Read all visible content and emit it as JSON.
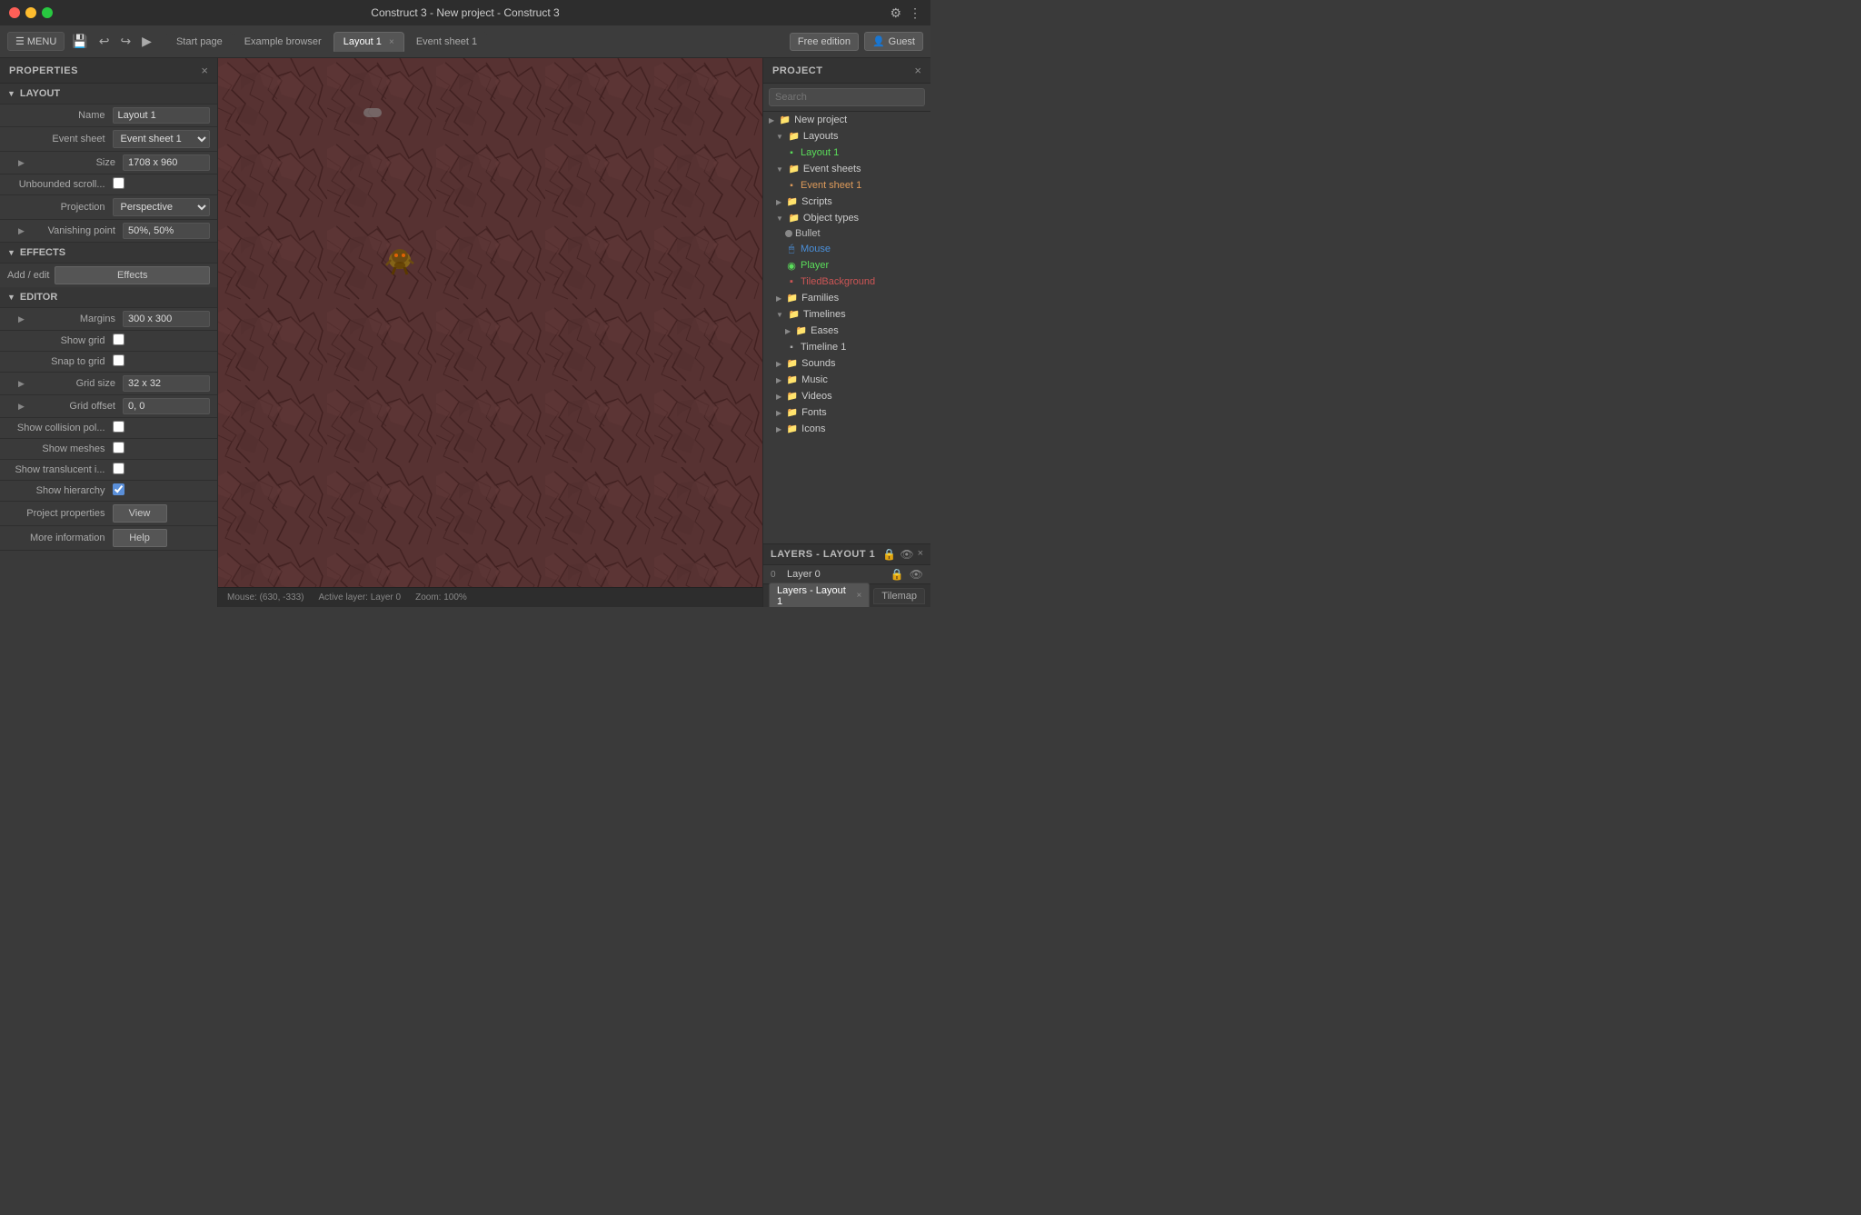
{
  "titlebar": {
    "title": "Construct 3 - New project - Construct 3",
    "close_label": "×",
    "settings_icon": "⚙",
    "dots_icon": "⋮"
  },
  "toolbar": {
    "menu_label": "MENU",
    "undo_icon": "↩",
    "redo_icon": "↪",
    "play_icon": "▶",
    "tabs": [
      {
        "id": "start",
        "label": "Start page",
        "active": false,
        "closable": false
      },
      {
        "id": "example",
        "label": "Example browser",
        "active": false,
        "closable": false
      },
      {
        "id": "layout1",
        "label": "Layout 1",
        "active": true,
        "closable": true
      },
      {
        "id": "eventsheet1",
        "label": "Event sheet 1",
        "active": false,
        "closable": false
      }
    ],
    "free_edition_label": "Free edition",
    "guest_label": "Guest"
  },
  "properties": {
    "panel_title": "PROPERTIES",
    "sections": {
      "layout": {
        "header": "LAYOUT",
        "name_label": "Name",
        "name_value": "Layout 1",
        "event_sheet_label": "Event sheet",
        "event_sheet_value": "Event sheet 1",
        "size_label": "Size",
        "size_value": "1708 x 960",
        "unbounded_scroll_label": "Unbounded scroll...",
        "projection_label": "Projection",
        "projection_value": "Perspective",
        "vanishing_point_label": "Vanishing point",
        "vanishing_point_value": "50%, 50%"
      },
      "effects": {
        "header": "EFFECTS",
        "add_edit_label": "Add / edit",
        "effects_btn_label": "Effects"
      },
      "editor": {
        "header": "EDITOR",
        "margins_label": "Margins",
        "margins_value": "300 x 300",
        "show_grid_label": "Show grid",
        "snap_to_grid_label": "Snap to grid",
        "grid_size_label": "Grid size",
        "grid_size_value": "32 x 32",
        "grid_offset_label": "Grid offset",
        "grid_offset_value": "0, 0",
        "show_collision_label": "Show collision pol...",
        "show_meshes_label": "Show meshes",
        "show_translucent_label": "Show translucent i...",
        "show_hierarchy_label": "Show hierarchy",
        "project_properties_label": "Project properties",
        "project_properties_btn": "View",
        "more_info_label": "More information",
        "more_info_btn": "Help"
      }
    }
  },
  "project": {
    "panel_title": "PROJECT",
    "search_placeholder": "Search",
    "tree": [
      {
        "level": 0,
        "type": "folder",
        "label": "New project",
        "expanded": true
      },
      {
        "level": 1,
        "type": "folder",
        "label": "Layouts",
        "expanded": true
      },
      {
        "level": 2,
        "type": "layout",
        "label": "Layout 1",
        "active": true
      },
      {
        "level": 1,
        "type": "folder",
        "label": "Event sheets",
        "expanded": true
      },
      {
        "level": 2,
        "type": "event",
        "label": "Event sheet 1",
        "active": true
      },
      {
        "level": 1,
        "type": "folder",
        "label": "Scripts",
        "expanded": false
      },
      {
        "level": 1,
        "type": "folder",
        "label": "Object types",
        "expanded": true
      },
      {
        "level": 2,
        "type": "obj_bullet",
        "label": "Bullet",
        "color": "gray"
      },
      {
        "level": 2,
        "type": "obj_mouse",
        "label": "Mouse",
        "color": "blue"
      },
      {
        "level": 2,
        "type": "obj_player",
        "label": "Player",
        "color": "green"
      },
      {
        "level": 2,
        "type": "obj_tiled",
        "label": "TiledBackground",
        "color": "tiled"
      },
      {
        "level": 1,
        "type": "folder",
        "label": "Families",
        "expanded": false
      },
      {
        "level": 1,
        "type": "folder",
        "label": "Timelines",
        "expanded": true
      },
      {
        "level": 2,
        "type": "folder",
        "label": "Eases",
        "expanded": false
      },
      {
        "level": 2,
        "type": "timeline",
        "label": "Timeline 1"
      },
      {
        "level": 1,
        "type": "folder",
        "label": "Sounds",
        "expanded": false
      },
      {
        "level": 1,
        "type": "folder",
        "label": "Music",
        "expanded": false
      },
      {
        "level": 1,
        "type": "folder",
        "label": "Videos",
        "expanded": false
      },
      {
        "level": 1,
        "type": "folder",
        "label": "Fonts",
        "expanded": false
      },
      {
        "level": 1,
        "type": "folder",
        "label": "Icons",
        "expanded": false
      }
    ]
  },
  "layers": {
    "panel_title": "LAYERS - LAYOUT 1",
    "rows": [
      {
        "num": "0",
        "label": "Layer 0"
      }
    ]
  },
  "status_bar": {
    "mouse_pos": "Mouse: (630, -333)",
    "active_layer": "Active layer: Layer 0",
    "zoom": "Zoom: 100%"
  },
  "canvas": {
    "bg_color": "#5c3535"
  },
  "bottom_tabs": [
    {
      "label": "Layers - Layout 1",
      "active": true,
      "closable": true
    },
    {
      "label": "Tilemap",
      "active": false,
      "closable": false
    }
  ]
}
